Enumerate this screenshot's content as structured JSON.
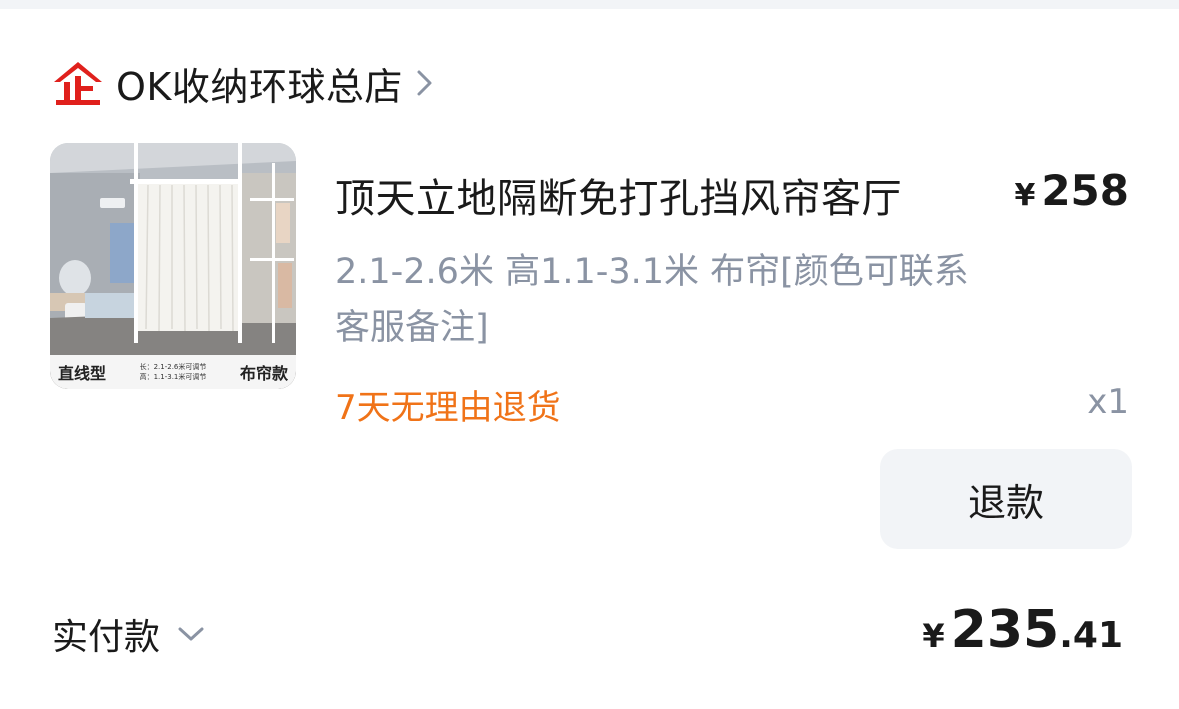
{
  "store": {
    "logo_icon": "enterprise-store-icon",
    "name": "OK收纳环球总店",
    "chevron_icon": "chevron-right-icon"
  },
  "product": {
    "image_caption_left": "直线型",
    "image_caption_mid_line1": "长：2.1-2.6米可调节",
    "image_caption_mid_line2": "高：1.1-3.1米可调节",
    "image_caption_right": "布帘款",
    "title": "顶天立地隔断免打孔挡风帘客厅",
    "price_currency": "¥",
    "price_amount": "258",
    "spec": "2.1-2.6米 高1.1-3.1米 布帘[颜色可联系客服备注]",
    "return_policy": "7天无理由退货",
    "quantity": "x1"
  },
  "actions": {
    "refund_label": "退款"
  },
  "payment": {
    "label": "实付款",
    "chevron_icon": "chevron-down-icon",
    "currency": "¥",
    "amount_int": "235",
    "amount_dec": ".41"
  },
  "colors": {
    "brand_red": "#e0201c",
    "accent_orange": "#f07318",
    "muted_text": "#8a93a3",
    "button_bg": "#f2f4f7"
  }
}
